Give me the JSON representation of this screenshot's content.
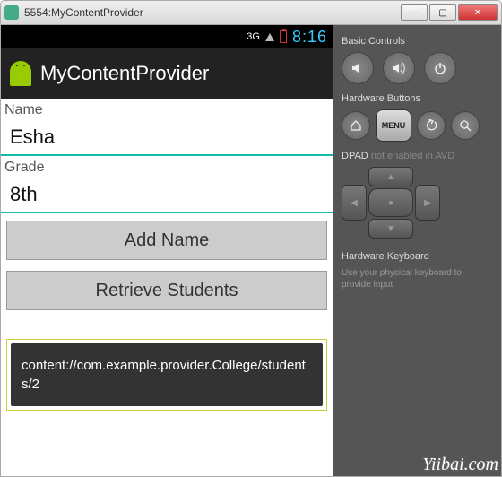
{
  "window": {
    "title": "5554:MyContentProvider",
    "min": "—",
    "max": "▢",
    "close": "✕"
  },
  "statusbar": {
    "net": "3G",
    "time": "8:16"
  },
  "appbar": {
    "title": "MyContentProvider"
  },
  "form": {
    "name_label": "Name",
    "name_value": "Esha",
    "grade_label": "Grade",
    "grade_value": "8th",
    "add_btn": "Add Name",
    "retrieve_btn": "Retrieve Students"
  },
  "toast": {
    "text": "content://com.example.provider.College/students/2"
  },
  "panel": {
    "basic_title": "Basic Controls",
    "hw_title": "Hardware Buttons",
    "menu_label": "MENU",
    "dpad_title": "DPAD",
    "dpad_note": "not enabled in AVD",
    "kb_title": "Hardware Keyboard",
    "kb_note": "Use your physical keyboard to provide input"
  },
  "watermark": "Yiibai.com"
}
